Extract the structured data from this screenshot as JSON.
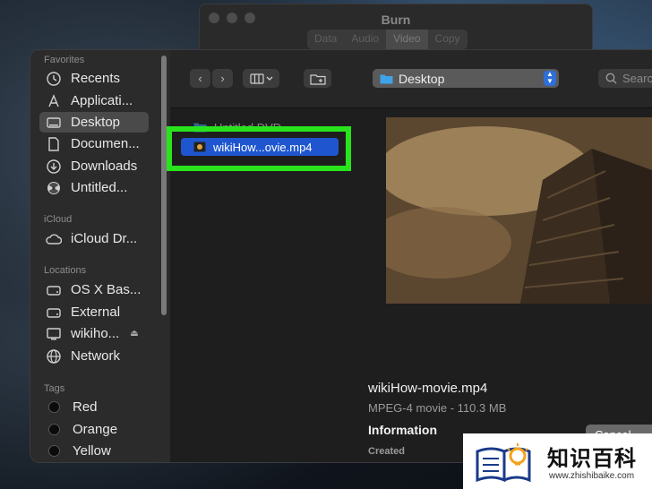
{
  "burn": {
    "title": "Burn",
    "tabs": [
      "Data",
      "Audio",
      "Video",
      "Copy"
    ],
    "active_tab": "Video"
  },
  "sidebar": {
    "favorites_header": "Favorites",
    "favorites": [
      {
        "label": "Recents",
        "icon": "clock-icon"
      },
      {
        "label": "Applicati...",
        "icon": "applications-icon"
      },
      {
        "label": "Desktop",
        "icon": "desktop-icon",
        "selected": true
      },
      {
        "label": "Documen...",
        "icon": "document-icon"
      },
      {
        "label": "Downloads",
        "icon": "download-icon"
      },
      {
        "label": "Untitled...",
        "icon": "burn-disc-icon"
      }
    ],
    "icloud_header": "iCloud",
    "icloud": [
      {
        "label": "iCloud Dr...",
        "icon": "cloud-icon"
      }
    ],
    "locations_header": "Locations",
    "locations": [
      {
        "label": "OS X Bas...",
        "icon": "drive-icon"
      },
      {
        "label": "External",
        "icon": "drive-icon"
      },
      {
        "label": "wikiho...",
        "icon": "computer-icon"
      },
      {
        "label": "Network",
        "icon": "globe-icon"
      }
    ],
    "tags_header": "Tags",
    "tags": [
      {
        "label": "Red"
      },
      {
        "label": "Orange"
      },
      {
        "label": "Yellow"
      }
    ]
  },
  "toolbar": {
    "location": "Desktop",
    "search_placeholder": "Search"
  },
  "browser": {
    "items": [
      {
        "label": "Untitled DVD",
        "kind": "folder"
      },
      {
        "label": "wikiHow...ovie.mp4",
        "kind": "video",
        "selected": true
      }
    ]
  },
  "preview": {
    "filename": "wikiHow-movie.mp4",
    "kind": "MPEG-4 movie - 110.3 MB",
    "info_header": "Information",
    "created_label": "Created"
  },
  "buttons": {
    "cancel": "Cancel"
  },
  "watermark": {
    "text": "知识百科",
    "url": "www.zhishibaike.com"
  },
  "colors": {
    "accent": "#1f56d0",
    "highlight": "#29e41c"
  }
}
